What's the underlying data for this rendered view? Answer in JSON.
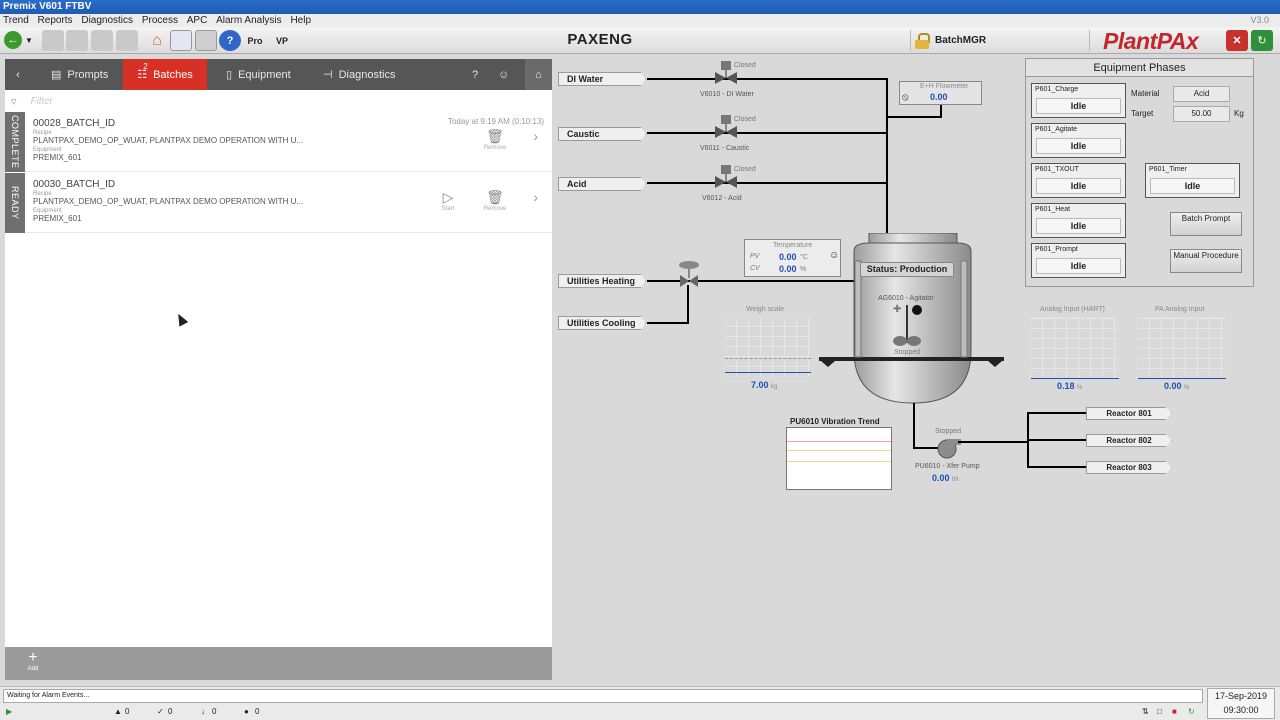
{
  "window": {
    "title": "Premix V601 FTBV",
    "version": "V3.0"
  },
  "menu": [
    "Trend",
    "Reports",
    "Diagnostics",
    "Process",
    "APC",
    "Alarm Analysis",
    "Help"
  ],
  "toolbar": {
    "display_name": "PAXENG",
    "user": "BatchMGR",
    "logo": "PlantPAx"
  },
  "batch_panel": {
    "tabs": [
      {
        "label": "Prompts",
        "icon": "prompts-icon"
      },
      {
        "label": "Batches",
        "icon": "batches-icon",
        "badge": "2",
        "active": true
      },
      {
        "label": "Equipment",
        "icon": "equipment-icon"
      },
      {
        "label": "Diagnostics",
        "icon": "diagnostics-icon"
      }
    ],
    "filter_placeholder": "Filter",
    "groups": [
      {
        "status": "COMPLETE",
        "batch": {
          "id": "00028_BATCH_ID",
          "recipe_label": "Recipe",
          "recipe": "PLANTPAX_DEMO_OP_WUAT, PLANTPAX DEMO OPERATION WITH U...",
          "equipment_label": "Equipment",
          "equipment": "PREMIX_601",
          "time": "Today at 9:19 AM (0:10:13)",
          "actions": [
            "Remove"
          ]
        }
      },
      {
        "status": "READY",
        "batch": {
          "id": "00030_BATCH_ID",
          "recipe_label": "Recipe",
          "recipe": "PLANTPAX_DEMO_OP_WUAT, PLANTPAX DEMO OPERATION WITH U...",
          "equipment_label": "Equipment",
          "equipment": "PREMIX_601",
          "time": "",
          "actions": [
            "Start",
            "Remove"
          ]
        }
      }
    ],
    "add_label": "Add"
  },
  "process": {
    "sources": [
      "DI Water",
      "Caustic",
      "Acid",
      "Utilities Heating",
      "Utilities Cooling"
    ],
    "valves": [
      {
        "tag": "V6010 - DI Water",
        "state": "Closed"
      },
      {
        "tag": "V6011 - Caustic",
        "state": "Closed"
      },
      {
        "tag": "V6012 - Acid",
        "state": "Closed"
      }
    ],
    "flowmeter": {
      "title": "E+H Flowmeter",
      "value": "0.00"
    },
    "temperature": {
      "title": "Temperature",
      "pv_label": "PV",
      "pv": "0.00",
      "pv_unit": "°C",
      "cv_label": "CV",
      "cv": "0.00",
      "cv_unit": "%"
    },
    "weigh_scale": {
      "title": "Weigh scale",
      "value": "7.00",
      "unit": "kg"
    },
    "tank": {
      "status": "Status: Production",
      "agitator_tag": "AG6010 - Agitator",
      "agitator_state": "Stopped"
    },
    "vibration_trend": {
      "title": "PU6010 Vibration Trend"
    },
    "pump": {
      "tag": "PU6010 - Xfer Pump",
      "state": "Stopped",
      "value": "0.00",
      "unit": "ft/t"
    },
    "analog_hart": {
      "title": "Analog Input (HART)",
      "value": "0.18",
      "unit": "%"
    },
    "pa_analog": {
      "title": "PA Analog Input",
      "value": "0.00",
      "unit": "%"
    },
    "reactors": [
      "Reactor 801",
      "Reactor 802",
      "Reactor 803"
    ]
  },
  "equipment_phases": {
    "title": "Equipment Phases",
    "phases": [
      {
        "name": "P601_Charge",
        "state": "Idle"
      },
      {
        "name": "P601_Agitate",
        "state": "Idle"
      },
      {
        "name": "P601_TXOUT",
        "state": "Idle"
      },
      {
        "name": "P601_Heat",
        "state": "Idle"
      },
      {
        "name": "P601_Prompt",
        "state": "Idle"
      },
      {
        "name": "P601_Timer",
        "state": "Idle"
      }
    ],
    "material_label": "Material",
    "material": "Acid",
    "target_label": "Target",
    "target": "50.00",
    "target_unit": "Kg",
    "batch_prompt": "Batch Prompt",
    "manual_procedure": "Manual Procedure"
  },
  "status_bar": {
    "message": "Waiting for Alarm Events...",
    "counts": [
      "0",
      "0",
      "0",
      "0"
    ],
    "date": "17-Sep-2019",
    "time": "09:30:00"
  },
  "colors": {
    "accent": "#d93025",
    "value_blue": "#1f4fb3",
    "logo_red": "#c2272d"
  }
}
